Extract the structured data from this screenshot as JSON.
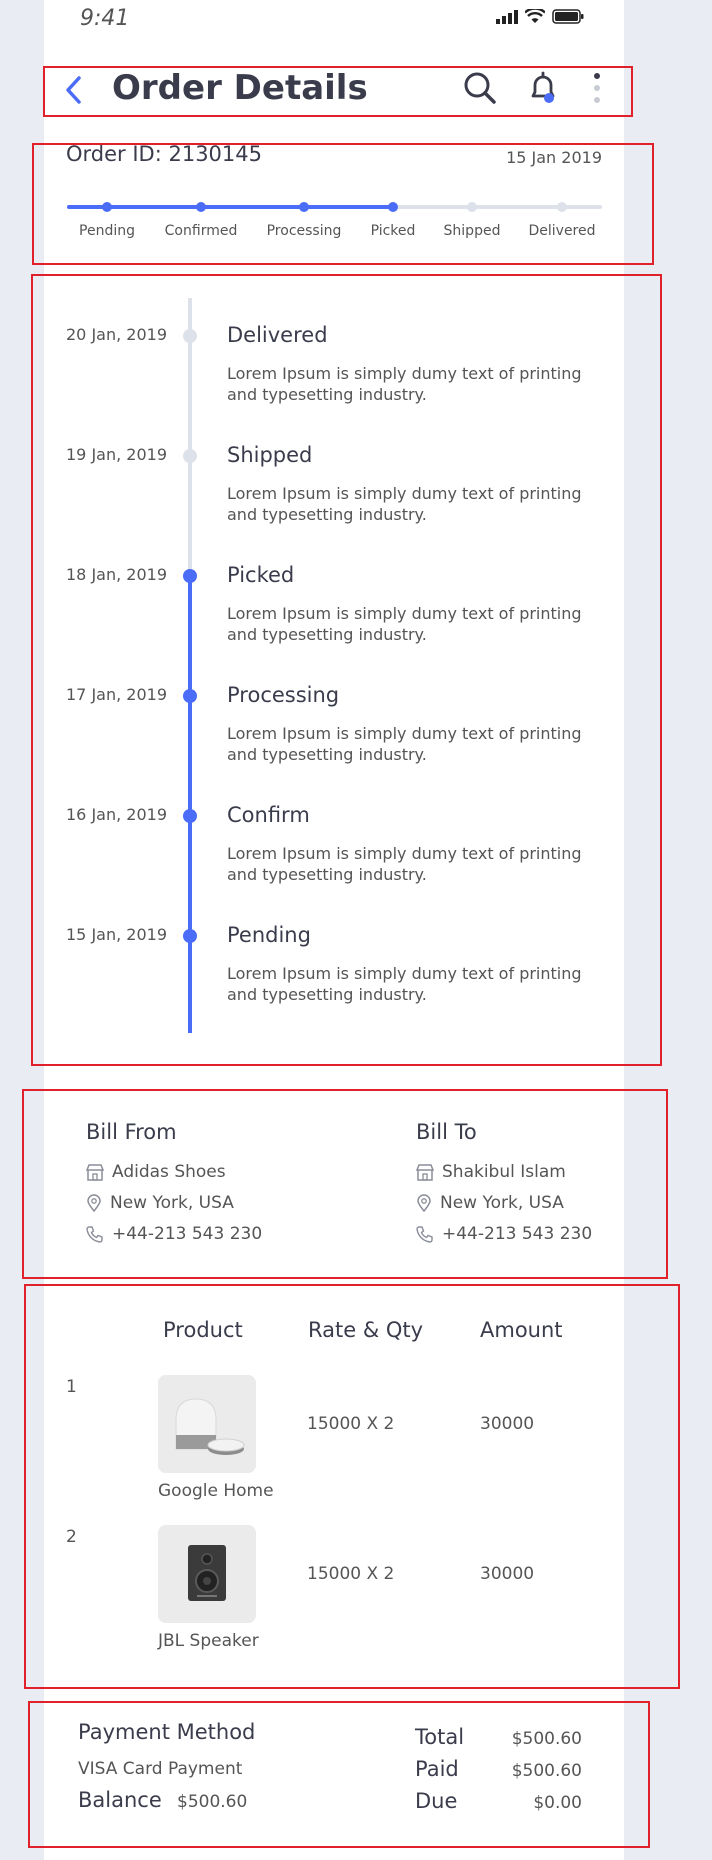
{
  "status_bar": {
    "time": "9:41"
  },
  "header": {
    "title": "Order Details"
  },
  "order": {
    "id_text": "Order ID: 2130145",
    "date": "15 Jan 2019",
    "steps": [
      "Pending",
      "Confirmed",
      "Processing",
      "Picked",
      "Shipped",
      "Delivered"
    ],
    "completed_steps": 4
  },
  "timeline": [
    {
      "date": "20 Jan, 2019",
      "title": "Delivered",
      "desc_line1": "Lorem Ipsum is simply dumy text of printing",
      "desc_line2": "and typesetting industry.",
      "done": false
    },
    {
      "date": "19 Jan, 2019",
      "title": "Shipped",
      "desc_line1": "Lorem Ipsum is simply dumy text of printing",
      "desc_line2": "and typesetting industry.",
      "done": false
    },
    {
      "date": "18 Jan, 2019",
      "title": "Picked",
      "desc_line1": "Lorem Ipsum is simply dumy text of printing",
      "desc_line2": "and typesetting industry.",
      "done": true
    },
    {
      "date": "17 Jan, 2019",
      "title": "Processing",
      "desc_line1": "Lorem Ipsum is simply dumy text of printing",
      "desc_line2": "and typesetting industry.",
      "done": true
    },
    {
      "date": "16 Jan, 2019",
      "title": "Confirm",
      "desc_line1": "Lorem Ipsum is simply dumy text of printing",
      "desc_line2": "and typesetting industry.",
      "done": true
    },
    {
      "date": "15 Jan, 2019",
      "title": "Pending",
      "desc_line1": "Lorem Ipsum is simply dumy text of printing",
      "desc_line2": "and typesetting industry.",
      "done": true
    }
  ],
  "bill_from": {
    "heading": "Bill From",
    "name": "Adidas Shoes",
    "location": "New York, USA",
    "phone": "+44-213 543 230"
  },
  "bill_to": {
    "heading": "Bill To",
    "name": "Shakibul Islam",
    "location": "New York, USA",
    "phone": "+44-213 543 230"
  },
  "products": {
    "headers": {
      "product": "Product",
      "rate_qty": "Rate & Qty",
      "amount": "Amount"
    },
    "items": [
      {
        "index": "1",
        "name": "Google Home",
        "rate_qty": "15000 X 2",
        "amount": "30000",
        "image": "smart-speaker-image"
      },
      {
        "index": "2",
        "name": "JBL Speaker",
        "rate_qty": "15000 X 2",
        "amount": "30000",
        "image": "bookshelf-speaker-image"
      }
    ]
  },
  "payment": {
    "title": "Payment Method",
    "method": "VISA Card Payment",
    "balance_label": "Balance",
    "balance_value": "$500.60",
    "total_label": "Total",
    "total_value": "$500.60",
    "paid_label": "Paid",
    "paid_value": "$500.60",
    "due_label": "Due",
    "due_value": "$0.00"
  },
  "colors": {
    "accent": "#4a6cf7",
    "inactive": "#dde1ea",
    "outline": "#e0202b",
    "text": "#3a3c4c"
  }
}
